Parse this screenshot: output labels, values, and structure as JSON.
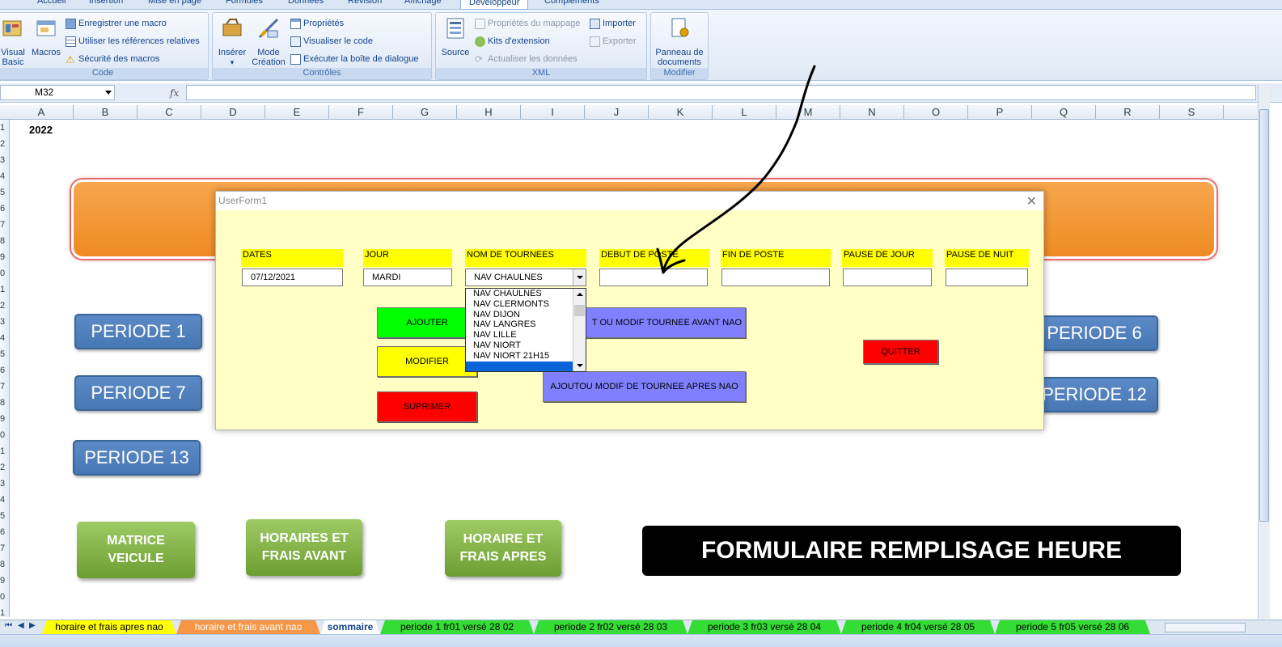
{
  "ribbon": {
    "tabs": [
      "Accueil",
      "Insertion",
      "Mise en page",
      "Formules",
      "Données",
      "Révision",
      "Affichage",
      "Développeur",
      "Compléments"
    ],
    "groups": {
      "code": {
        "label": "Code",
        "visual_basic": "Visual\nBasic",
        "macros": "Macros",
        "record_macro": "Enregistrer une macro",
        "relative_refs": "Utiliser les références relatives",
        "macro_security": "Sécurité des macros"
      },
      "controls": {
        "label": "Contrôles",
        "insert": "Insérer",
        "design_mode": "Mode\nCréation",
        "properties": "Propriétés",
        "view_code": "Visualiser le code",
        "run_dialog": "Exécuter la boîte de dialogue"
      },
      "xml": {
        "label": "XML",
        "source": "Source",
        "map_properties": "Propriétés du mappage",
        "expansion_packs": "Kits d'extension",
        "refresh_data": "Actualiser les données",
        "import": "Importer",
        "export": "Exporter"
      },
      "modify": {
        "label": "Modifier",
        "document_panel": "Panneau de\ndocuments"
      }
    }
  },
  "formula_bar": {
    "name_box": "M32",
    "fx": "fx",
    "formula": ""
  },
  "sheet": {
    "columns": [
      "A",
      "B",
      "C",
      "D",
      "E",
      "F",
      "G",
      "H",
      "I",
      "J",
      "K",
      "L",
      "M",
      "N",
      "O",
      "P",
      "Q",
      "R",
      "S"
    ],
    "rows": [
      "1",
      "2",
      "3",
      "4",
      "5",
      "6",
      "7",
      "8",
      "9",
      "0",
      "1",
      "2",
      "3",
      "4",
      "5",
      "6",
      "7",
      "8",
      "9",
      "0",
      "1",
      "2",
      "3",
      "4",
      "5",
      "6",
      "7",
      "8",
      "9",
      "0",
      "1"
    ],
    "cell_a1": "2022",
    "buttons": {
      "periode1": "PERIODE 1",
      "periode7": "PERIODE 7",
      "periode13": "PERIODE 13",
      "periode6": "PERIODE  6",
      "periode12": "PERIODE 12",
      "matrice": "MATRICE\nVEICULE",
      "horaires_avant": "HORAIRES ET\nFRAIS AVANT",
      "horaire_apres": "HORAIRE ET\nFRAIS APRES",
      "formulaire": "FORMULAIRE REMPLISAGE HEURE"
    }
  },
  "userform": {
    "title": "UserForm1",
    "close": "✕",
    "labels": {
      "dates": "DATES",
      "jour": "JOUR",
      "tournees": "NOM DE TOURNEES",
      "debut": "DEBUT DE POSTE",
      "fin": "FIN DE POSTE",
      "pause_jour": "PAUSE DE JOUR",
      "pause_nuit": "PAUSE DE NUIT"
    },
    "values": {
      "dates": "07/12/2021",
      "jour": "MARDI",
      "tournees": "NAV CHAULNES",
      "debut": "",
      "fin": "",
      "pause_jour": "",
      "pause_nuit": ""
    },
    "dropdown_options": [
      "NAV CHAULNES",
      "NAV CLERMONTS",
      "NAV DIJON",
      "NAV LANGRES",
      "NAV LILLE",
      "NAV NIORT",
      "NAV NIORT 21H15"
    ],
    "buttons": {
      "ajouter": "AJOUTER",
      "modifier": "MODIFIER",
      "suprimer": "SUPRIMER",
      "avant_nao": "T OU MODIF TOURNEE AVANT NAO",
      "apres_nao": "AJOUTOU MODIF  DE TOURNEE APRES NAO",
      "quitter": "QUITTER"
    }
  },
  "sheet_tabs": [
    {
      "label": "horaire et frais apres nao",
      "color": "#ffff00"
    },
    {
      "label": "horaire et frais avant nao",
      "color": "#f79646"
    },
    {
      "label": "sommaire",
      "color": "#ffffff"
    },
    {
      "label": "periode 1  fr01 versé 28  02",
      "color": "#33dd33"
    },
    {
      "label": "periode 2  fr02 versé 28  03",
      "color": "#33dd33"
    },
    {
      "label": "periode 3  fr03 versé 28  04",
      "color": "#33dd33"
    },
    {
      "label": "periode 4 fr04 versé 28  05",
      "color": "#33dd33"
    },
    {
      "label": "periode 5  fr05 versé 28  06",
      "color": "#33dd33"
    }
  ],
  "colors": {
    "ajouter": "#00ff00",
    "modifier": "#ffff00",
    "suprimer": "#ff0000",
    "quitter": "#ff0000",
    "nao_buttons": "#8080ff",
    "form_bg": "#ffffc6"
  }
}
